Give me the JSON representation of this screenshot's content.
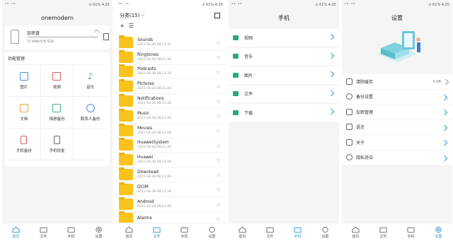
{
  "status": {
    "left": "⁴ᴳ ⁴ᴳ",
    "right": "⊙ 61% 4:25"
  },
  "colors": {
    "accent": "#2f8fd8",
    "folder": "#f9c31b",
    "green": "#2aa87a"
  },
  "home": {
    "title": "onemodern",
    "storage": {
      "name": "加密盘",
      "percent": "0%",
      "size": "17.6MB/476.5GB"
    },
    "functions_title": "功能管理",
    "functions": [
      {
        "label": "图片",
        "icon": "image-icon",
        "color": "#4a90d9"
      },
      {
        "label": "视频",
        "icon": "video-icon",
        "color": "#e05a5a"
      },
      {
        "label": "音乐",
        "icon": "music-icon",
        "color": "#3bb37a"
      },
      {
        "label": "文档",
        "icon": "document-icon",
        "color": "#e8a33a"
      },
      {
        "label": "相册备份",
        "icon": "album-backup-icon",
        "color": "#3bb37a"
      },
      {
        "label": "联系人备份",
        "icon": "contact-backup-icon",
        "color": "#4a90d9"
      },
      {
        "label": "手机备份",
        "icon": "phone-backup-icon",
        "color": "#e05a5a"
      },
      {
        "label": "手机恢复",
        "icon": "phone-restore-icon",
        "color": "#666666"
      }
    ]
  },
  "files": {
    "sort_label": "分类(15)",
    "add": "+",
    "view": "☰",
    "items": [
      {
        "name": "Sounds",
        "date": "2021-04-28 08:21:32"
      },
      {
        "name": "Ringtones",
        "date": "2021-04-28 08:21:28"
      },
      {
        "name": "Podcasts",
        "date": "2021-04-28 08:21:28"
      },
      {
        "name": "Pictures",
        "date": "2021-04-28 08:21:28"
      },
      {
        "name": "Notifications",
        "date": "2021-04-28 08:21:28"
      },
      {
        "name": "Music",
        "date": "2021-04-28 08:21:28"
      },
      {
        "name": "Movies",
        "date": "2021-04-28 08:21:28"
      },
      {
        "name": "HuaweiSystem",
        "date": "2021-04-28 08:21:28"
      },
      {
        "name": "Huawei",
        "date": "2021-04-28 08:21:28"
      },
      {
        "name": "Download",
        "date": "2021-04-28 08:21:28"
      },
      {
        "name": "DCIM",
        "date": "2021-04-28 08:21:28"
      },
      {
        "name": "Android",
        "date": "2021-04-28 08:21:28"
      },
      {
        "name": "Alarms",
        "date": ""
      }
    ]
  },
  "phone": {
    "title": "手机",
    "items": [
      "视频",
      "音乐",
      "图片",
      "文件",
      "下载"
    ]
  },
  "settings": {
    "title": "设置",
    "items": [
      {
        "label": "清除缓存",
        "value": "0.0B"
      },
      {
        "label": "备份设置",
        "value": ""
      },
      {
        "label": "加密管理",
        "value": ""
      },
      {
        "label": "语言",
        "value": ""
      },
      {
        "label": "关于",
        "value": ""
      },
      {
        "label": "隐私协议",
        "value": ""
      }
    ]
  },
  "nav": [
    "首页",
    "文件",
    "手机",
    "设置"
  ]
}
